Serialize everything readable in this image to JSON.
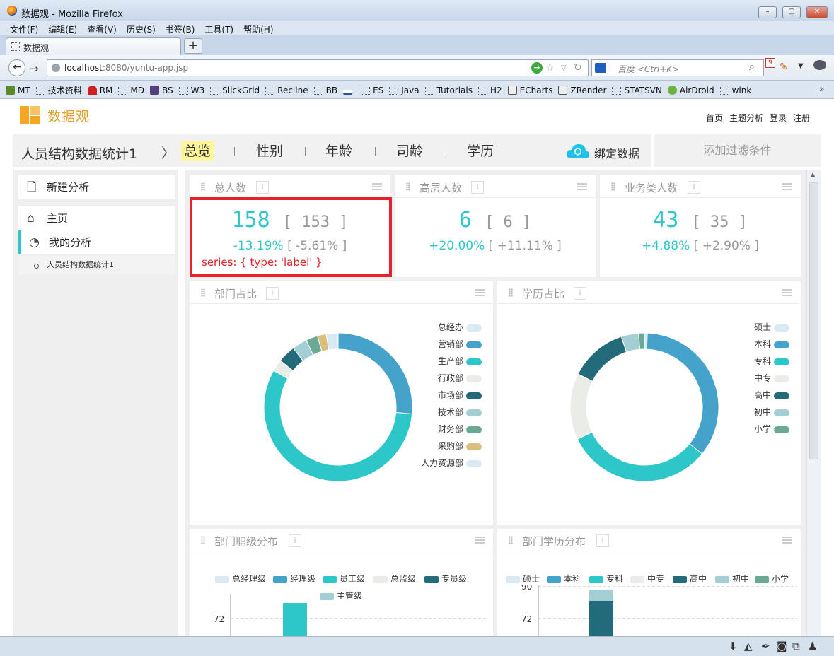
{
  "window": {
    "title": "数据观 - Mozilla Firefox"
  },
  "menu": [
    "文件(F)",
    "编辑(E)",
    "查看(V)",
    "历史(S)",
    "书签(B)",
    "工具(T)",
    "帮助(H)"
  ],
  "tab": {
    "title": "数据观"
  },
  "url": {
    "host": "localhost",
    "rest": ":8080/yuntu-app.jsp"
  },
  "search": {
    "placeholder": "百度 <Ctrl+K>",
    "badge": "9"
  },
  "bookmarks": [
    "MT",
    "技术资料",
    "RM",
    "MD",
    "BS",
    "W3",
    "SlickGrid",
    "Recline",
    "BB",
    "ES",
    "Java",
    "Tutorials",
    "H2",
    "ECharts",
    "ZRender",
    "STATSVN",
    "AirDroid",
    "wink"
  ],
  "app": {
    "brand": "数据观",
    "toplinks": [
      "首页",
      "主题分析",
      "登录",
      "注册"
    ],
    "breadcrumb": "人员结构数据统计1",
    "tabs": [
      "总览",
      "性别",
      "年龄",
      "司龄",
      "学历"
    ],
    "bind_data": "绑定数据",
    "add_filter": "添加过滤条件"
  },
  "sidebar": {
    "new_analysis": "新建分析",
    "home": "主页",
    "my_analysis": "我的分析",
    "item": "人员结构数据统计1"
  },
  "kpis": [
    {
      "title": "总人数",
      "value": "158",
      "compare": "153",
      "change": "-13.19%",
      "change_compare": "-5.61%"
    },
    {
      "title": "高层人数",
      "value": "6",
      "compare": "6",
      "change": "+20.00%",
      "change_compare": "+11.11%"
    },
    {
      "title": "业务类人数",
      "value": "43",
      "compare": "35",
      "change": "+4.88%",
      "change_compare": "+2.90%"
    }
  ],
  "annotation": "series: { type: 'label' }",
  "colors": {
    "c1": "#daeaf5",
    "c2": "#44a2cb",
    "c3": "#2ec7c9",
    "c4": "#e9ece7",
    "c5": "#236a7a",
    "c6": "#a2ced4",
    "c7": "#6aaa94",
    "c8": "#d8c07c"
  },
  "charts": {
    "dept_title": "部门占比",
    "edu_title": "学历占比",
    "dept_level_title": "部门职级分布",
    "dept_edu_title": "部门学历分布"
  },
  "chart_data": [
    {
      "type": "pie",
      "title": "部门占比",
      "categories": [
        "总经办",
        "营销部",
        "生产部",
        "行政部",
        "市场部",
        "技术部",
        "财务部",
        "采购部",
        "人力资源部"
      ],
      "values": [
        0,
        41,
        88,
        4,
        6,
        5,
        4,
        3,
        4
      ],
      "colors": [
        "#daeaf5",
        "#44a2cb",
        "#2ec7c9",
        "#e9ece7",
        "#236a7a",
        "#a2ced4",
        "#6aaa94",
        "#d8c07c",
        "#daeaf5"
      ],
      "legend": "right"
    },
    {
      "type": "pie",
      "title": "学历占比",
      "categories": [
        "硕士",
        "本科",
        "专科",
        "中专",
        "高中",
        "初中",
        "小学"
      ],
      "values": [
        1,
        56,
        51,
        23,
        20,
        6,
        2
      ],
      "colors": [
        "#daeaf5",
        "#44a2cb",
        "#2ec7c9",
        "#e9ece7",
        "#236a7a",
        "#a2ced4",
        "#6aaa94"
      ],
      "legend": "right"
    },
    {
      "type": "bar",
      "title": "部门职级分布",
      "legend": [
        "总经理级",
        "经理级",
        "员工级",
        "总监级",
        "专员级",
        "主管级"
      ],
      "ytick": "72",
      "values": {
        "员工级": 80
      }
    },
    {
      "type": "bar",
      "title": "部门学历分布",
      "legend": [
        "硕士",
        "本科",
        "专科",
        "中专",
        "高中",
        "初中",
        "小学"
      ],
      "yticks": [
        "90",
        "72"
      ],
      "values": {
        "高中": 60,
        "初中": 20
      }
    }
  ]
}
